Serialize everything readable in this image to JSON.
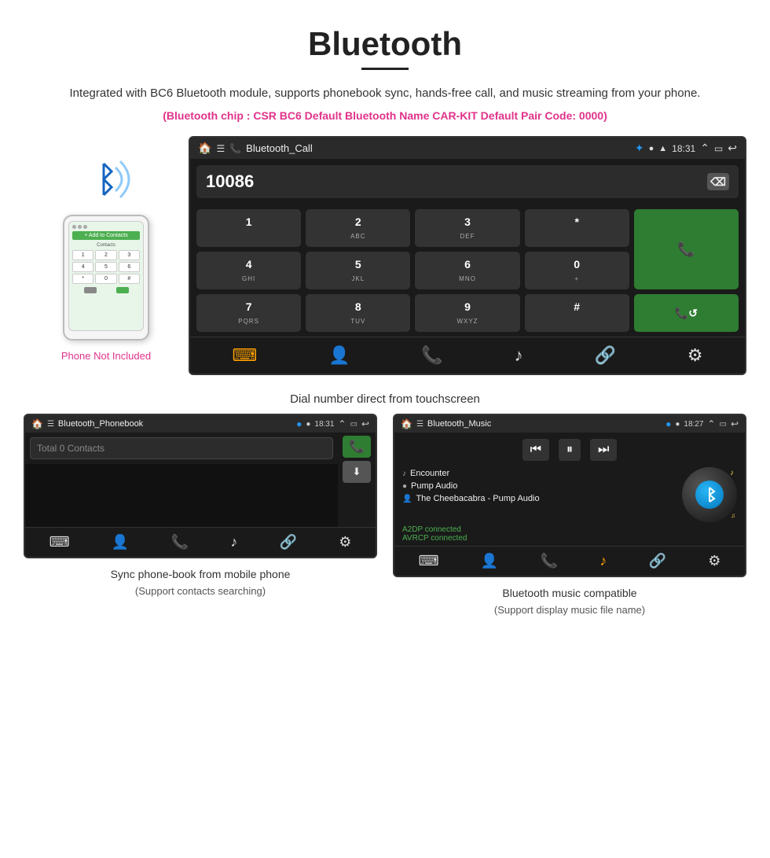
{
  "page": {
    "title": "Bluetooth",
    "subtitle": "Integrated with BC6 Bluetooth module, supports phonebook sync, hands-free call, and music streaming from your phone.",
    "chip_info": "(Bluetooth chip : CSR BC6     Default Bluetooth Name CAR-KIT     Default Pair Code: 0000)"
  },
  "car_screen": {
    "app_name": "Bluetooth_Call",
    "status_time": "18:31",
    "dialed_number": "10086",
    "keys": [
      {
        "label": "1",
        "sub": ""
      },
      {
        "label": "2",
        "sub": "ABC"
      },
      {
        "label": "3",
        "sub": "DEF"
      },
      {
        "label": "*",
        "sub": ""
      },
      {
        "label": "4",
        "sub": "GHI"
      },
      {
        "label": "5",
        "sub": "JKL"
      },
      {
        "label": "6",
        "sub": "MNO"
      },
      {
        "label": "0",
        "sub": "+"
      },
      {
        "label": "7",
        "sub": "PQRS"
      },
      {
        "label": "8",
        "sub": "TUV"
      },
      {
        "label": "9",
        "sub": "WXYZ"
      },
      {
        "label": "#",
        "sub": ""
      }
    ]
  },
  "dial_caption": "Dial number direct from touchscreen",
  "phone_not_included": "Phone Not Included",
  "phonebook_screen": {
    "app_name": "Bluetooth_Phonebook",
    "status_time": "18:31",
    "search_placeholder": "Total 0 Contacts"
  },
  "music_screen": {
    "app_name": "Bluetooth_Music",
    "status_time": "18:27",
    "tracks": [
      {
        "icon": "♪",
        "name": "Encounter"
      },
      {
        "icon": "●",
        "name": "Pump Audio"
      },
      {
        "icon": "👤",
        "name": "The Cheebacabra - Pump Audio"
      }
    ],
    "connected": [
      "A2DP connected",
      "AVRCP connected"
    ]
  },
  "captions": {
    "phonebook": "Sync phone-book from mobile phone",
    "phonebook_sub": "(Support contacts searching)",
    "music": "Bluetooth music compatible",
    "music_sub": "(Support display music file name)"
  }
}
